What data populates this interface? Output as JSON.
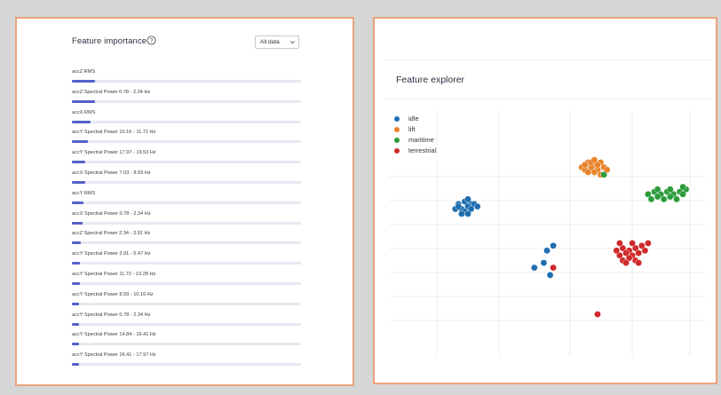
{
  "feature_importance": {
    "title": "Feature importance",
    "help_icon": "question-circle-icon",
    "select": {
      "value": "All data"
    },
    "rows": [
      {
        "label": "accZ RMS",
        "value": 0.1
      },
      {
        "label": "accZ Spectral Power 0.78 - 2.34 Hz",
        "value": 0.1
      },
      {
        "label": "accX RMS",
        "value": 0.08
      },
      {
        "label": "accY Spectral Power 10.16 - 11.72 Hz",
        "value": 0.07
      },
      {
        "label": "accY Spectral Power 17.97 - 19.53 Hz",
        "value": 0.06
      },
      {
        "label": "accX Spectral Power 7.03 - 8.59 Hz",
        "value": 0.06
      },
      {
        "label": "accY RMS",
        "value": 0.05
      },
      {
        "label": "accX Spectral Power 0.78 - 2.34 Hz",
        "value": 0.045
      },
      {
        "label": "accZ Spectral Power 2.34 - 3.91 Hz",
        "value": 0.04
      },
      {
        "label": "accY Spectral Power 3.91 - 5.47 Hz",
        "value": 0.035
      },
      {
        "label": "accY Spectral Power 11.72 - 13.28 Hz",
        "value": 0.035
      },
      {
        "label": "accY Spectral Power 8.59 - 10.16 Hz",
        "value": 0.03
      },
      {
        "label": "accY Spectral Power 0.78 - 2.34 Hz",
        "value": 0.03
      },
      {
        "label": "accY Spectral Power 14.84 - 16.41 Hz",
        "value": 0.03
      },
      {
        "label": "accY Spectral Power 16.41 - 17.97 Hz",
        "value": 0.03
      }
    ],
    "bar_color": "#5560c9"
  },
  "feature_explorer": {
    "title": "Feature explorer",
    "legend": [
      {
        "label": "idle",
        "color": "#1f6fb0"
      },
      {
        "label": "lift",
        "color": "#e8832a"
      },
      {
        "label": "maritime",
        "color": "#2c9c3b"
      },
      {
        "label": "terrestrial",
        "color": "#d0292b"
      }
    ]
  },
  "chart_data": {
    "type": "scatter",
    "title": "Feature explorer",
    "xlabel": "",
    "ylabel": "",
    "grid": true,
    "legend_position": "top-left",
    "xlim": [
      0,
      10
    ],
    "ylim": [
      0,
      10
    ],
    "series": [
      {
        "name": "idle",
        "color": "#1f6fb0",
        "x": [
          2.2,
          2.4,
          2.6,
          2.3,
          2.5,
          2.7,
          2.1,
          2.4,
          2.6,
          2.3,
          2.5,
          2.8,
          2.2,
          2.5,
          5.0,
          5.2,
          4.6,
          5.1,
          4.9
        ],
        "y": [
          6.2,
          6.3,
          6.2,
          6.0,
          6.1,
          6.2,
          6.0,
          5.9,
          6.0,
          5.8,
          5.8,
          6.1,
          6.1,
          6.4,
          4.3,
          4.5,
          3.6,
          3.3,
          3.8
        ]
      },
      {
        "name": "lift",
        "color": "#e8832a",
        "x": [
          6.1,
          6.3,
          6.5,
          6.7,
          6.2,
          6.4,
          6.6,
          6.8,
          6.3,
          6.5,
          6.7,
          6.4,
          6.6,
          6.2,
          6.9,
          6.5,
          8.3
        ],
        "y": [
          7.7,
          7.9,
          7.8,
          7.9,
          7.6,
          7.7,
          7.6,
          7.7,
          7.5,
          7.5,
          7.4,
          7.9,
          7.8,
          7.8,
          7.6,
          8.0,
          6.4
        ]
      },
      {
        "name": "maritime",
        "color": "#2c9c3b",
        "x": [
          8.2,
          8.4,
          8.6,
          8.8,
          9.0,
          9.2,
          9.4,
          8.3,
          8.5,
          8.7,
          8.9,
          9.1,
          9.3,
          8.5,
          8.9,
          9.3,
          6.8
        ],
        "y": [
          6.6,
          6.7,
          6.6,
          6.7,
          6.6,
          6.7,
          6.8,
          6.4,
          6.5,
          6.4,
          6.5,
          6.4,
          6.6,
          6.8,
          6.8,
          6.9,
          7.4
        ]
      },
      {
        "name": "terrestrial",
        "color": "#d0292b",
        "x": [
          7.2,
          7.4,
          7.6,
          7.8,
          8.0,
          7.3,
          7.5,
          7.7,
          7.9,
          8.1,
          7.4,
          7.6,
          7.8,
          7.5,
          7.9,
          8.2,
          7.3,
          7.7,
          5.2,
          6.6
        ],
        "y": [
          4.3,
          4.4,
          4.3,
          4.4,
          4.5,
          4.1,
          4.2,
          4.1,
          4.2,
          4.3,
          3.9,
          4.0,
          3.9,
          3.8,
          3.8,
          4.6,
          4.6,
          4.6,
          3.6,
          1.7
        ]
      }
    ]
  }
}
